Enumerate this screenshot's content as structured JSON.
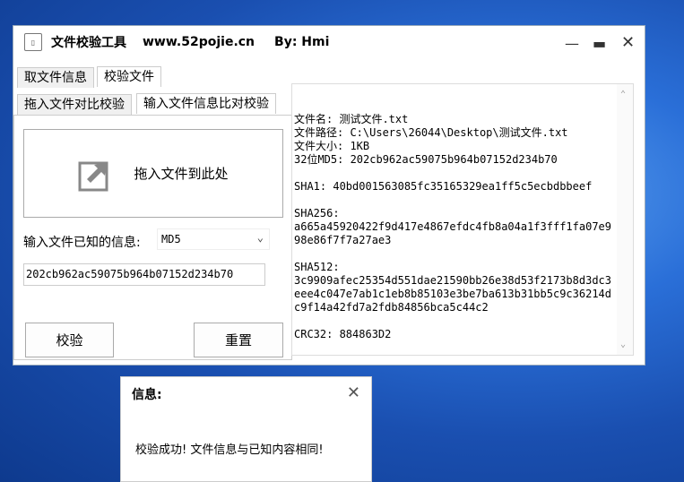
{
  "window": {
    "title": "文件校验工具",
    "site": "www.52pojie.cn",
    "author": "By: Hmi",
    "icon": "app-icon",
    "controls": [
      "minimize",
      "maximize",
      "close"
    ]
  },
  "tabs": [
    "取文件信息",
    "校验文件"
  ],
  "subtabs": [
    "拖入文件对比校验",
    "输入文件信息比对校验"
  ],
  "drop": {
    "label": "拖入文件到此处",
    "icon": "drop-arrow-icon"
  },
  "known": {
    "label": "输入文件已知的信息:",
    "type": "MD5",
    "value": "202cb962ac59075b964b07152d234b70"
  },
  "buttons": {
    "verify": "校验",
    "reset": "重置"
  },
  "info": "文件名: 测试文件.txt\n文件路径: C:\\Users\\26044\\Desktop\\测试文件.txt\n文件大小: 1KB\n32位MD5: 202cb962ac59075b964b07152d234b70\n\nSHA1: 40bd001563085fc35165329ea1ff5c5ecbdbbeef\n\nSHA256:\na665a45920422f9d417e4867efdc4fb8a04a1f3fff1fa07e998e86f7f7a27ae3\n\nSHA512:\n3c9909afec25354d551dae21590bb26e38d53f2173b8d3dc3eee4c047e7ab1c1eb8b85103e3be7ba613b31bb5c9c36214dc9f14a42fd7a2fdb84856bca5c44c2\n\nCRC32: 884863D2",
  "dialog": {
    "title": "信息:",
    "message": "校验成功! 文件信息与已知内容相同!"
  }
}
